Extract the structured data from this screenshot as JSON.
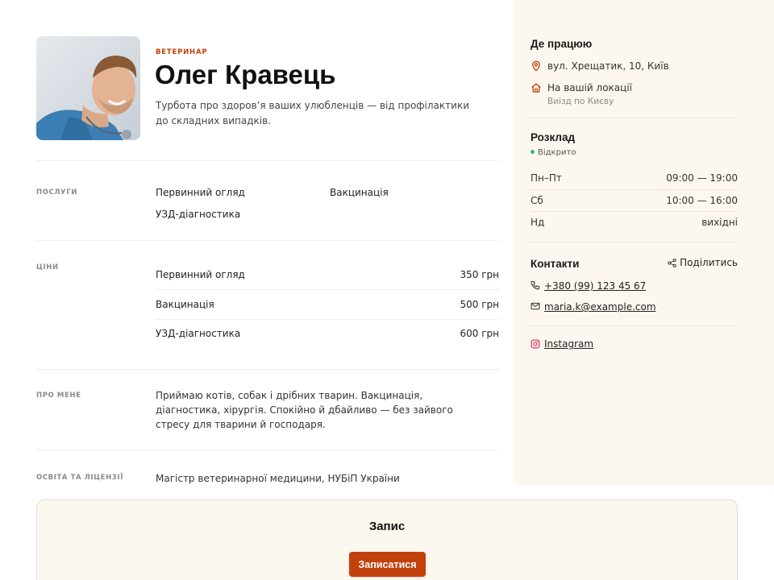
{
  "profile": {
    "role": "ВЕТЕРИНАР",
    "name": "Олег Кравець",
    "tagline": "Турбота про здоров’я ваших улюбленців — від профілактики до складних випадків."
  },
  "sections": {
    "services": {
      "label": "ПОСЛУГИ",
      "items": [
        "Первинний огляд",
        "Вакцинація",
        "УЗД-діагностика"
      ]
    },
    "prices": {
      "label": "ЦІНИ",
      "rows": [
        {
          "name": "Первинний огляд",
          "price": "350 грн"
        },
        {
          "name": "Вакцинація",
          "price": "500 грн"
        },
        {
          "name": "УЗД-діагностика",
          "price": "600 грн"
        }
      ]
    },
    "about": {
      "label": "ПРО МЕНЕ",
      "text": "Приймаю котів, собак і дрібних тварин. Вакцинація, діагностика, хірургія. Спокійно й дбайливо — без зайвого стресу для тварини й господаря."
    },
    "education": {
      "label": "ОСВІТА ТА ЛІЦЕНЗІЇ",
      "text": "Магістр ветеринарної медицини, НУБіП України"
    }
  },
  "sidebar": {
    "where": {
      "title": "Де працюю",
      "address": "вул. Хрещатик, 10, Київ",
      "home_visit": "На вашій локації",
      "home_visit_sub": "Виїзд по Києву"
    },
    "schedule": {
      "title": "Розклад",
      "status": "Відкрито",
      "status_color": "#22c55e",
      "rows": [
        {
          "day": "Пн–Пт",
          "hours": "09:00 — 19:00"
        },
        {
          "day": "Сб",
          "hours": "10:00 — 16:00"
        },
        {
          "day": "Нд",
          "hours": "вихідні"
        }
      ]
    },
    "contacts": {
      "title": "Контакти",
      "share": "Поділитись",
      "phone": "+380 (99) 123 45 67",
      "email": "maria.k@example.com",
      "instagram": "Instagram"
    }
  },
  "booking": {
    "title": "Запис",
    "button": "Записатися"
  },
  "colors": {
    "accent": "#c2410c",
    "sidebar_bg": "#fdf8ef",
    "open_dot": "#22c55e",
    "instagram": "#e1306c"
  }
}
